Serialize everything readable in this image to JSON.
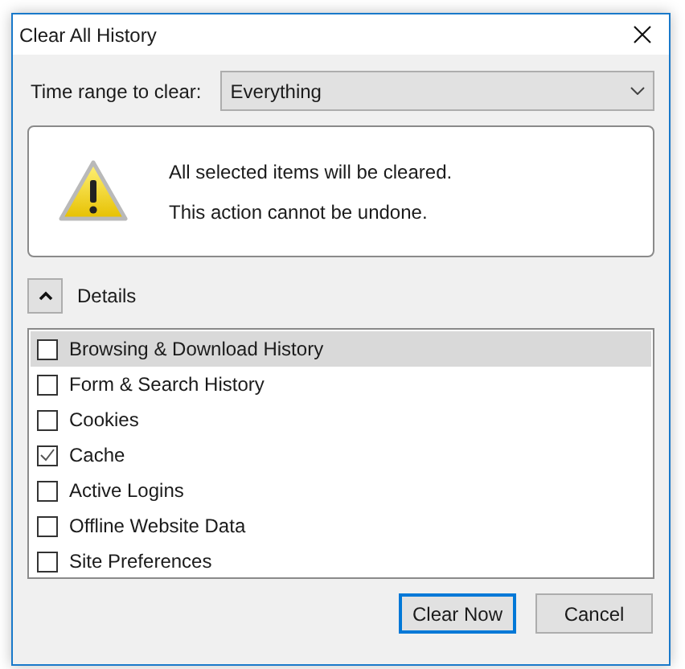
{
  "window": {
    "title": "Clear All History"
  },
  "time_range": {
    "label": "Time range to clear:",
    "value": "Everything"
  },
  "warning": {
    "lines": [
      "All selected items will be cleared.",
      "This action cannot be undone."
    ]
  },
  "details": {
    "label": "Details",
    "expanded": true
  },
  "items": [
    {
      "label": "Browsing & Download History",
      "checked": false,
      "selected": true
    },
    {
      "label": "Form & Search History",
      "checked": false,
      "selected": false
    },
    {
      "label": "Cookies",
      "checked": false,
      "selected": false
    },
    {
      "label": "Cache",
      "checked": true,
      "selected": false
    },
    {
      "label": "Active Logins",
      "checked": false,
      "selected": false
    },
    {
      "label": "Offline Website Data",
      "checked": false,
      "selected": false
    },
    {
      "label": "Site Preferences",
      "checked": false,
      "selected": false
    }
  ],
  "buttons": [
    {
      "label": "Clear Now",
      "default": true
    },
    {
      "label": "Cancel",
      "default": false
    }
  ]
}
